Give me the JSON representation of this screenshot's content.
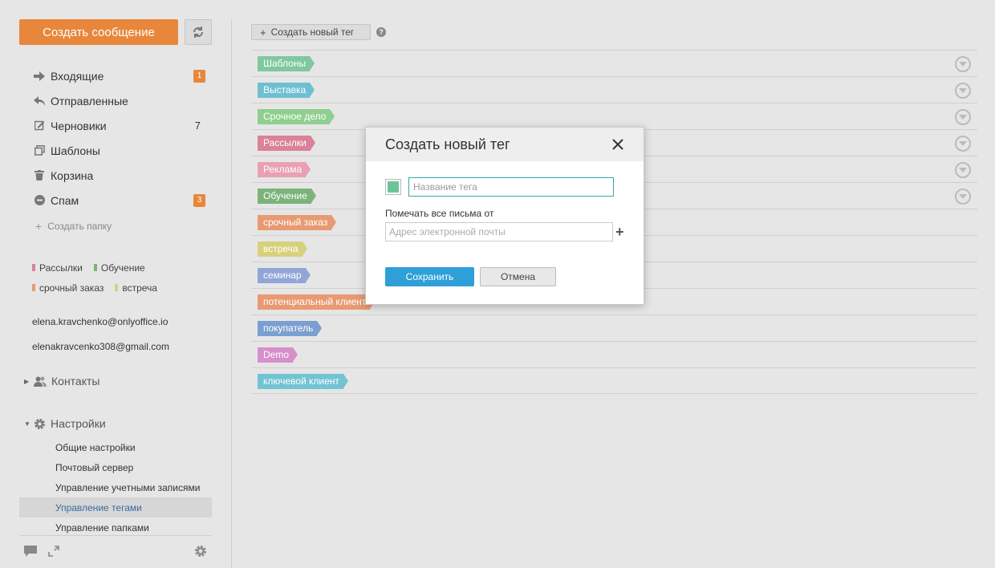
{
  "sidebar": {
    "compose_label": "Создать сообщение",
    "folders": [
      {
        "label": "Входящие",
        "badge": "1",
        "icon": "arrow-right-icon"
      },
      {
        "label": "Отправленные",
        "icon": "reply-icon"
      },
      {
        "label": "Черновики",
        "count": "7",
        "icon": "edit-icon"
      },
      {
        "label": "Шаблоны",
        "icon": "copy-icon"
      },
      {
        "label": "Корзина",
        "icon": "trash-icon"
      },
      {
        "label": "Спам",
        "badge": "3",
        "icon": "block-icon"
      }
    ],
    "create_folder_label": "Создать папку",
    "tag_legend": [
      {
        "label": "Рассылки",
        "color": "#d9829a"
      },
      {
        "label": "Обучение",
        "color": "#7bb37b"
      },
      {
        "label": "срочный заказ",
        "color": "#e89a72"
      },
      {
        "label": "встреча",
        "color": "#d7d17e"
      }
    ],
    "accounts": [
      "elena.kravchenko@onlyoffice.io",
      "elenakravcenko308@gmail.com"
    ],
    "contacts_label": "Контакты",
    "settings_label": "Настройки",
    "settings_items": [
      "Общие настройки",
      "Почтовый сервер",
      "Управление учетными записями",
      "Управление тегами",
      "Управление папками"
    ],
    "active_settings_index": 3
  },
  "main": {
    "new_tag_label": "Создать новый тег",
    "tags": [
      {
        "label": "Шаблоны",
        "color": "#7fc8a0"
      },
      {
        "label": "Выставка",
        "color": "#6fbfd2"
      },
      {
        "label": "Срочное дело",
        "color": "#8fcf8f"
      },
      {
        "label": "Рассылки",
        "color": "#d9829a"
      },
      {
        "label": "Реклама",
        "color": "#eaa0b4"
      },
      {
        "label": "Обучение",
        "color": "#7bb37b"
      },
      {
        "label": "срочный заказ",
        "color": "#e89a72"
      },
      {
        "label": "встреча",
        "color": "#d7d17e"
      },
      {
        "label": "семинар",
        "color": "#8fa6d6"
      },
      {
        "label": "потенциальный клиент",
        "color": "#e89a72"
      },
      {
        "label": "покупатель",
        "color": "#7a9fd0"
      },
      {
        "label": "Demo",
        "color": "#d68fcb"
      },
      {
        "label": "ключевой клиент",
        "color": "#72c4d2"
      }
    ]
  },
  "dialog": {
    "title": "Создать новый тег",
    "selected_color": "#6cc59a",
    "name_placeholder": "Название тега",
    "mark_label": "Помечать все письма от",
    "email_placeholder": "Адрес электронной почты",
    "save_label": "Сохранить",
    "cancel_label": "Отмена"
  }
}
